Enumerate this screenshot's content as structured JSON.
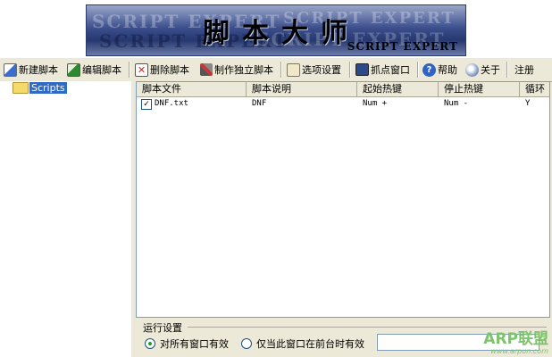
{
  "banner": {
    "title": "脚本大师",
    "subtitle": "SCRIPT EXPERT",
    "ghost_text": "SCRIPT EXPERT"
  },
  "toolbar": {
    "new_script": "新建脚本",
    "edit_script": "编辑脚本",
    "delete_script": "删除脚本",
    "make_standalone": "制作独立脚本",
    "options": "选项设置",
    "capture_window": "抓点窗口",
    "help": "帮助",
    "about": "关于",
    "register": "注册"
  },
  "tree": {
    "root": "Scripts"
  },
  "list": {
    "columns": [
      "脚本文件",
      "脚本说明",
      "起始热键",
      "停止热键",
      "循环"
    ],
    "rows": [
      {
        "checked": true,
        "file": "DNF.txt",
        "desc": "DNF",
        "start": "Num +",
        "stop": "Num -",
        "loop": "Y"
      }
    ]
  },
  "settings": {
    "title": "运行设置",
    "opt_all": "对所有窗口有效",
    "opt_front": "仅当此窗口在前台时有效",
    "input_value": ""
  },
  "watermark": {
    "main": "ARP联盟",
    "url": "www.arpun.com"
  }
}
